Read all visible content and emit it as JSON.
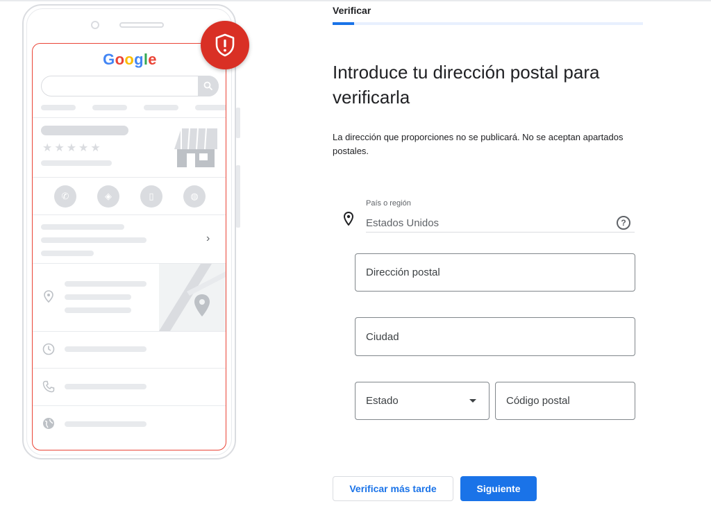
{
  "phone_preview": {
    "logo_letters": [
      {
        "char": "G",
        "color": "#4285f4"
      },
      {
        "char": "o",
        "color": "#ea4335"
      },
      {
        "char": "o",
        "color": "#fbbc05"
      },
      {
        "char": "g",
        "color": "#4285f4"
      },
      {
        "char": "l",
        "color": "#34a853"
      },
      {
        "char": "e",
        "color": "#ea4335"
      }
    ],
    "stars": "★★★★★",
    "chevron": "›",
    "badge_color": "#d93025"
  },
  "header": {
    "step_title": "Verificar",
    "progress": 0.07
  },
  "main": {
    "headline": "Introduce tu dirección postal para verificarla",
    "description": "La dirección que proporciones no se publicará. No se aceptan apartados postales."
  },
  "form": {
    "country_label": "País o región",
    "country_value": "Estados Unidos",
    "help_glyph": "?",
    "address_placeholder": "Dirección postal",
    "city_placeholder": "Ciudad",
    "state_value": "Estado",
    "zip_placeholder": "Código postal"
  },
  "actions": {
    "later_label": "Verificar más tarde",
    "next_label": "Siguiente"
  },
  "colors": {
    "accent": "#1a73e8",
    "alert": "#d93025"
  }
}
